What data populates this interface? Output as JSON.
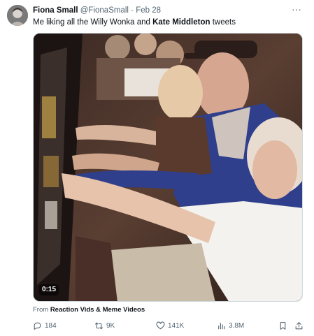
{
  "post": {
    "author_name": "Fiona Small",
    "author_handle": "@FionaSmall",
    "separator": "·",
    "date": "Feb 28",
    "more_label": "···",
    "text_prefix": "Me liking all the Willy Wonka and ",
    "text_bold": "Kate Middleton",
    "text_suffix": " tweets"
  },
  "media": {
    "duration": "0:15",
    "from_label": "From ",
    "from_source": "Reaction Vids & Meme Videos"
  },
  "actions": {
    "replies": "184",
    "retweets": "9K",
    "likes": "141K",
    "views": "3.8M"
  },
  "icons": [
    "avatar",
    "more-icon",
    "reply-icon",
    "retweet-icon",
    "like-icon",
    "views-icon",
    "bookmark-icon",
    "share-icon"
  ],
  "colors": {
    "text": "#0f1419",
    "muted": "#536471",
    "border": "#cfd9de"
  }
}
